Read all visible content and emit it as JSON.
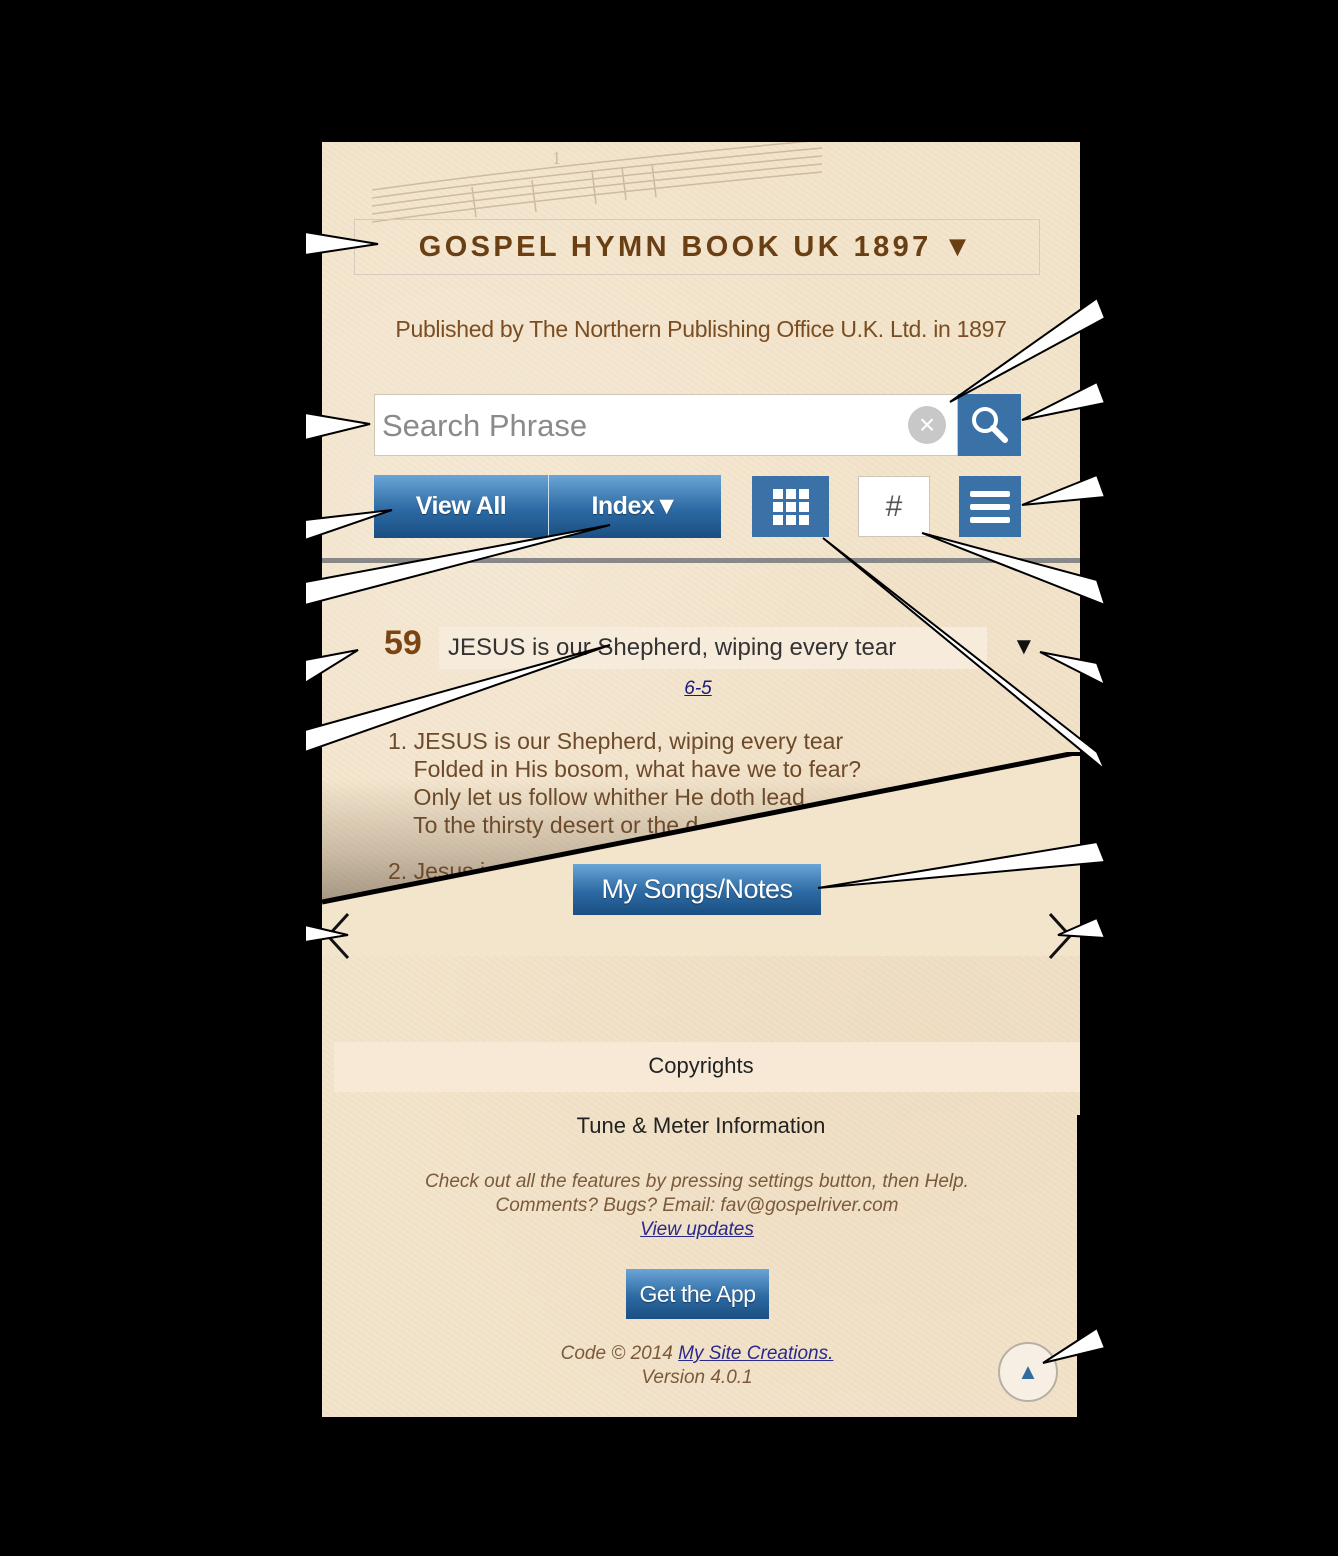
{
  "header": {
    "book_title": "GOSPEL HYMN BOOK UK 1897 ▼",
    "publisher": "Published by The Northern Publishing Office U.K. Ltd. in 1897"
  },
  "search": {
    "placeholder": "Search Phrase",
    "value": "",
    "clear_icon": "×",
    "search_icon": "search-icon"
  },
  "toolbar": {
    "view_all_label": "View All",
    "index_label": "Index▼",
    "grid_icon": "grid-icon",
    "hash_label": "#",
    "menu_icon": "hamburger-menu-icon"
  },
  "song": {
    "number": "59",
    "title": "JESUS is our Shepherd, wiping every tear",
    "dropdown_icon": "▼",
    "meter": "6-5",
    "verse1": [
      "1. JESUS is our Shepherd, wiping every tear",
      "    Folded in His bosom, what have we to fear?",
      "    Only let us follow whither He doth lead",
      "    To the thirsty desert or the d"
    ],
    "verse2_start": "2. Jesus i"
  },
  "actions": {
    "my_songs_label": "My Songs/Notes",
    "prev_icon": "‹",
    "next_icon": "›"
  },
  "footer": {
    "copyrights": "Copyrights",
    "tune_meter": "Tune & Meter Information",
    "help_line": "Check out all the features by pressing settings button, then Help.",
    "email_line": "Comments? Bugs? Email: fav@gospelriver.com",
    "view_updates": "View updates",
    "get_app_label": "Get the App",
    "code_prefix": "Code © 2014 ",
    "site_link": "My Site Creations.",
    "version": "Version 4.0.1",
    "top_icon": "▲"
  },
  "colors": {
    "accent_blue": "#3a72a8",
    "title_brown": "#6b3f14",
    "paper": "#f3e4cc"
  }
}
